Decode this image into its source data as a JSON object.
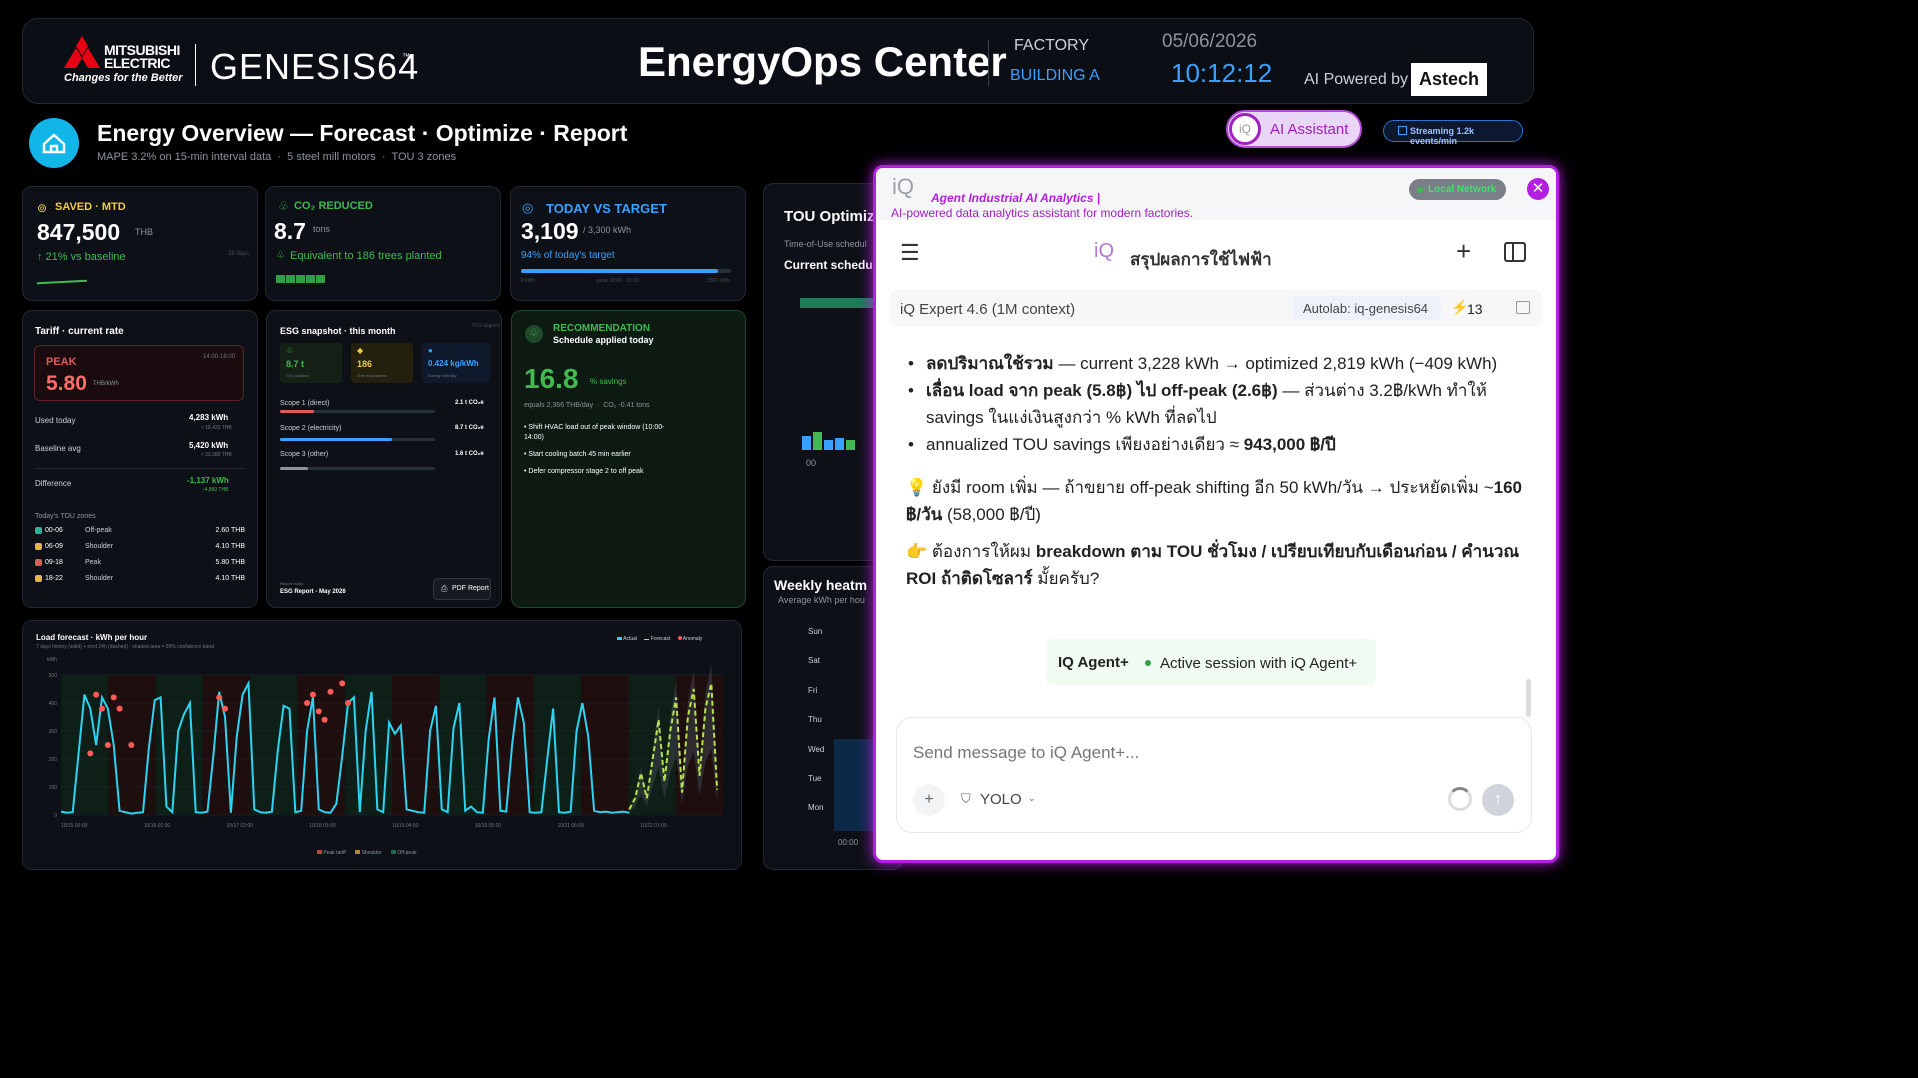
{
  "header": {
    "brand_top": "MITSUBISHI",
    "brand_bottom": "ELECTRIC",
    "brand_tagline": "Changes for the Better",
    "product": "GENESIS64",
    "product_tm": "™",
    "title": "EnergyOps Center",
    "factory_label": "FACTORY",
    "building": "BUILDING A",
    "date": "05/06/2026",
    "time": "10:12:12",
    "ai_powered": "AI Powered by",
    "astech": "Astech"
  },
  "overview": {
    "title": "Energy Overview — Forecast · Optimize · Report",
    "subtitle": "MAPE 3.2% on 15-min interval data  ·  5 steel mill motors  ·  TOU 3 zones",
    "ai_assistant": "AI Assistant",
    "streaming": "Streaming 1.2k events/min"
  },
  "kpi_saved": {
    "label": "SAVED · MTD",
    "value": "847,500",
    "unit": "THB",
    "delta": "↑ 21% vs baseline",
    "note": "26 days"
  },
  "kpi_co2": {
    "label": "CO₂ REDUCED",
    "value": "8.7",
    "unit": "tons",
    "note": "Equivalent to 186 trees planted"
  },
  "kpi_today": {
    "label": "TODAY VS TARGET",
    "value": "3,109",
    "unit": "/ 3,300 kWh",
    "note": "94% of today's target",
    "progress": 0.94,
    "scale_left": "0 kWh",
    "scale_mid": "peak 18:00 - 22:00",
    "scale_right": "3300 kWh"
  },
  "tariff": {
    "title": "Tariff · current rate",
    "peak_label": "PEAK",
    "peak_window": "14:00-18:00",
    "peak_value": "5.80",
    "peak_unit": "THB/kWh",
    "rows": [
      {
        "label": "Used today",
        "value": "4,283 kWh",
        "sub": "≈ 18,420 THB"
      },
      {
        "label": "Baseline avg",
        "value": "5,420 kWh",
        "sub": "≈ 23,280 THB"
      },
      {
        "label": "Difference",
        "value": "-1,137 kWh",
        "sub": "-4,860 THB"
      }
    ],
    "zones_title": "Today's TOU zones",
    "zones": [
      {
        "time": "00-06",
        "name": "Off-peak",
        "rate": "2.60 THB",
        "color": "#2bb39a"
      },
      {
        "time": "06-09",
        "name": "Shoulder",
        "rate": "4.10 THB",
        "color": "#e0b84a"
      },
      {
        "time": "09-18",
        "name": "Peak",
        "rate": "5.80 THB",
        "color": "#e05a5a"
      },
      {
        "time": "18-22",
        "name": "Shoulder",
        "rate": "4.10 THB",
        "color": "#e0b84a"
      }
    ]
  },
  "esg": {
    "title": "ESG snapshot · this month",
    "tag": "TGO-aligned",
    "tiles": [
      {
        "value": "8.7 t",
        "label": "CO₂ avoided",
        "color": "#3fb950"
      },
      {
        "value": "186",
        "label": "Tree equivalents",
        "color": "#f2cc3a"
      },
      {
        "value": "0.424 kg/kWh",
        "label": "Energy intensity",
        "color": "#3aa0ff"
      }
    ],
    "scopes": [
      {
        "label": "Scope 1 (direct)",
        "value": "2.1 t CO₂e",
        "fill": 0.22,
        "color": "#e05a5a"
      },
      {
        "label": "Scope 2 (electricity)",
        "value": "8.7 t CO₂e",
        "fill": 0.72,
        "color": "#3aa0ff"
      },
      {
        "label": "Scope 3 (other)",
        "value": "1.6 t CO₂e",
        "fill": 0.18,
        "color": "#8b949e"
      }
    ],
    "report_ready": "Report ready",
    "report_name": "ESG Report - May 2026",
    "pdf_button": "PDF Report"
  },
  "recommendation": {
    "title": "RECOMMENDATION",
    "subtitle": "Schedule applied today",
    "value": "16.8",
    "unit": "% savings",
    "equals": "equals 2,366 THB/day  ·  CO₂ -0.41 tons",
    "bullets": [
      "Shift HVAC load out of peak window (10:00-14:00)",
      "Start cooling batch 45 min earlier",
      "Defer compressor stage 2 to off peak"
    ]
  },
  "tou": {
    "title": "TOU Optimiz",
    "sub": "Time-of-Use schedul",
    "current": "Current schedu",
    "axis": "00"
  },
  "heatmap": {
    "title": "Weekly heatm",
    "sub": "Average kWh per hou",
    "days": [
      "Sun",
      "Sat",
      "Fri",
      "Thu",
      "Wed",
      "Tue",
      "Mon"
    ],
    "x_label": "00:00"
  },
  "forecast": {
    "title": "Load forecast · kWh per hour",
    "subtitle": "7 days history (solid) + next 24h (dashed) · shaded area = 90% confidence band",
    "legend": [
      "Actual",
      "Forecast",
      "Anomaly"
    ],
    "footer_legend": [
      "Peak tariff",
      "Shoulder",
      "Off-peak"
    ],
    "kwh_label": "kWh"
  },
  "chart_data": {
    "type": "line",
    "title": "Load forecast · kWh per hour",
    "ylabel": "kWh",
    "ylim": [
      0,
      500
    ],
    "yticks": [
      500,
      400,
      300,
      200,
      100,
      0
    ],
    "xticks": [
      "10/15 00:00",
      "10/16 01:00",
      "10/17 02:00",
      "10/18 03:00",
      "10/19 04:00",
      "10/20 05:00",
      "10/21 06:00",
      "10/22 07:00"
    ],
    "series": [
      {
        "name": "Actual",
        "values": [
          12,
          8,
          10,
          220,
          430,
          380,
          250,
          420,
          380,
          250,
          15,
          10,
          5,
          8,
          10,
          240,
          410,
          420,
          30,
          10,
          300,
          360,
          400,
          10,
          8,
          12,
          210,
          440,
          350,
          8,
          280,
          430,
          470,
          20,
          10,
          8,
          12,
          230,
          390,
          380,
          10,
          15,
          300,
          420,
          20,
          10,
          8,
          40,
          210,
          400,
          420,
          10,
          300,
          440,
          20,
          10,
          330,
          290,
          320,
          20,
          15,
          10,
          8,
          300,
          390,
          20,
          10,
          310,
          400,
          15,
          30,
          10,
          8,
          270,
          420,
          15,
          12,
          250,
          420,
          330,
          10,
          8,
          10,
          200,
          380,
          10,
          8,
          12,
          300,
          400,
          280,
          15,
          10,
          12,
          8,
          10,
          12,
          8
        ]
      },
      {
        "name": "Forecast",
        "values": [
          20,
          60,
          150,
          60,
          200,
          340,
          120,
          300,
          420,
          80,
          350,
          450,
          140,
          380,
          470,
          90
        ]
      }
    ],
    "anomalies": [
      [
        5,
        220
      ],
      [
        6,
        430
      ],
      [
        7,
        380
      ],
      [
        8,
        250
      ],
      [
        9,
        420
      ],
      [
        10,
        380
      ],
      [
        12,
        250
      ],
      [
        27,
        420
      ],
      [
        28,
        380
      ],
      [
        42,
        400
      ],
      [
        43,
        430
      ],
      [
        44,
        370
      ],
      [
        45,
        340
      ],
      [
        46,
        440
      ],
      [
        48,
        470
      ],
      [
        49,
        400
      ]
    ]
  },
  "panel": {
    "brand": "iQ",
    "header_title": "Agent Industrial AI Analytics |",
    "header_sub": "AI-powered data analytics assistant for modern factories.",
    "local_network": "Local Network",
    "chat_title": "สรุปผลการใช้ไฟฟ้า",
    "model": "iQ Expert 4.6 (1M context)",
    "autolab": "Autolab: iq-genesis64",
    "count": "13",
    "bullets": [
      {
        "b1": "ลดปริมาณใช้รวม",
        "rest": " — current 3,228 kWh → optimized 2,819 kWh (−409 kWh)"
      },
      {
        "b1": "เลื่อน load จาก peak (5.8฿) ไป off-peak (2.6฿)",
        "rest": " — ส่วนต่าง 3.2฿/kWh ทำให้ savings ในแง่เงินสูงกว่า % kWh ที่ลดไป"
      },
      {
        "b1": "",
        "rest": "annualized TOU savings เพียงอย่างเดียว ≈ ",
        "b2": "943,000 ฿/ปี"
      }
    ],
    "tip_icon": "💡",
    "tip_text": " ยังมี room เพิ่ม — ถ้าขยาย off-peak shifting อีก 50 kWh/วัน → ประหยัดเพิ่ม ~",
    "tip_bold": "160 ฿/วัน",
    "tip_tail": " (58,000 ฿/ปี)",
    "ask_icon": "👉",
    "ask_text": " ต้องการให้ผม ",
    "ask_bold1": "breakdown ตาม TOU ชั่วโมง / เปรียบเทียบกับเดือนก่อน / คำนวณ ROI ถ้าติดโซลาร์",
    "ask_tail": " มั้ยครับ?",
    "agent_label": "IQ Agent+",
    "agent_status": "Active session with iQ Agent+",
    "input_placeholder": "Send message to iQ Agent+...",
    "yolo": "YOLO"
  }
}
